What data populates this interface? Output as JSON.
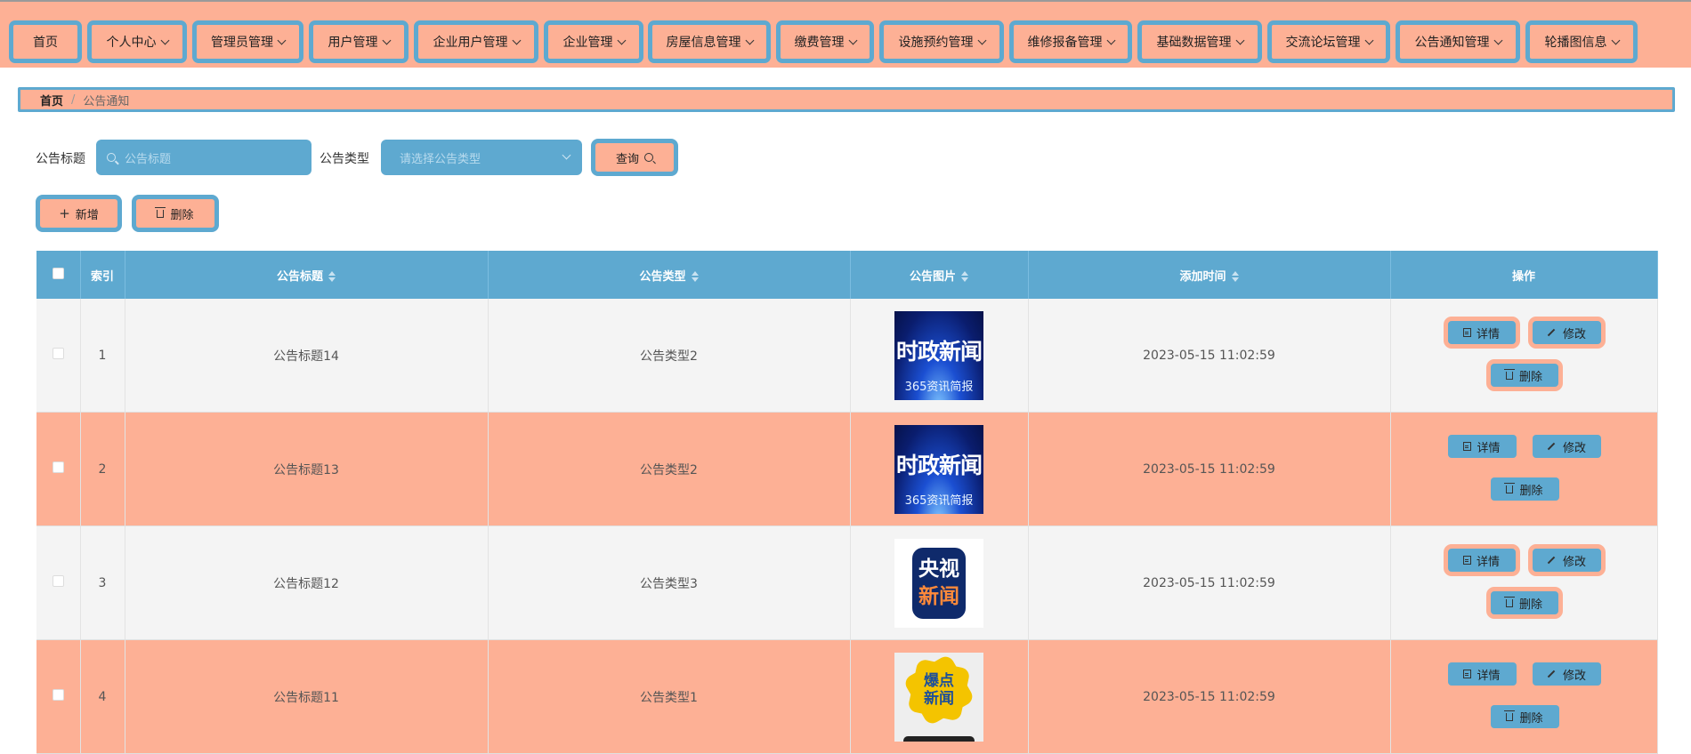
{
  "nav": [
    {
      "label": "首页",
      "has_menu": false
    },
    {
      "label": "个人中心",
      "has_menu": true
    },
    {
      "label": "管理员管理",
      "has_menu": true
    },
    {
      "label": "用户管理",
      "has_menu": true
    },
    {
      "label": "企业用户管理",
      "has_menu": true
    },
    {
      "label": "企业管理",
      "has_menu": true
    },
    {
      "label": "房屋信息管理",
      "has_menu": true
    },
    {
      "label": "缴费管理",
      "has_menu": true
    },
    {
      "label": "设施预约管理",
      "has_menu": true
    },
    {
      "label": "维修报备管理",
      "has_menu": true
    },
    {
      "label": "基础数据管理",
      "has_menu": true
    },
    {
      "label": "交流论坛管理",
      "has_menu": true
    },
    {
      "label": "公告通知管理",
      "has_menu": true
    },
    {
      "label": "轮播图信息",
      "has_menu": true
    }
  ],
  "breadcrumb": {
    "home": "首页",
    "current": "公告通知"
  },
  "search": {
    "title_label": "公告标题",
    "title_placeholder": "公告标题",
    "type_label": "公告类型",
    "type_placeholder": "请选择公告类型",
    "query_button": "查询"
  },
  "actions": {
    "add": "新增",
    "delete": "删除"
  },
  "table": {
    "headers": {
      "index": "索引",
      "title": "公告标题",
      "type": "公告类型",
      "image": "公告图片",
      "time": "添加时间",
      "ops": "操作"
    },
    "op_labels": {
      "detail": "详情",
      "edit": "修改",
      "delete": "删除"
    },
    "rows": [
      {
        "index": "1",
        "title": "公告标题14",
        "type": "公告类型2",
        "image": {
          "style": "news-blue",
          "text1": "时政新闻",
          "text2": "365资讯简报"
        },
        "time": "2023-05-15 11:02:59"
      },
      {
        "index": "2",
        "title": "公告标题13",
        "type": "公告类型2",
        "image": {
          "style": "news-blue",
          "text1": "时政新闻",
          "text2": "365资讯简报"
        },
        "time": "2023-05-15 11:02:59"
      },
      {
        "index": "3",
        "title": "公告标题12",
        "type": "公告类型3",
        "image": {
          "style": "cctv",
          "text1": "央视",
          "text2": "新闻"
        },
        "time": "2023-05-15 11:02:59"
      },
      {
        "index": "4",
        "title": "公告标题11",
        "type": "公告类型1",
        "image": {
          "style": "burst",
          "text1": "爆点",
          "text2": "新闻"
        },
        "time": "2023-05-15 11:02:59"
      }
    ]
  },
  "colors": {
    "accent_blue": "#5ea9d0",
    "salmon": "#fdb095",
    "row_gray": "#f4f4f4"
  }
}
